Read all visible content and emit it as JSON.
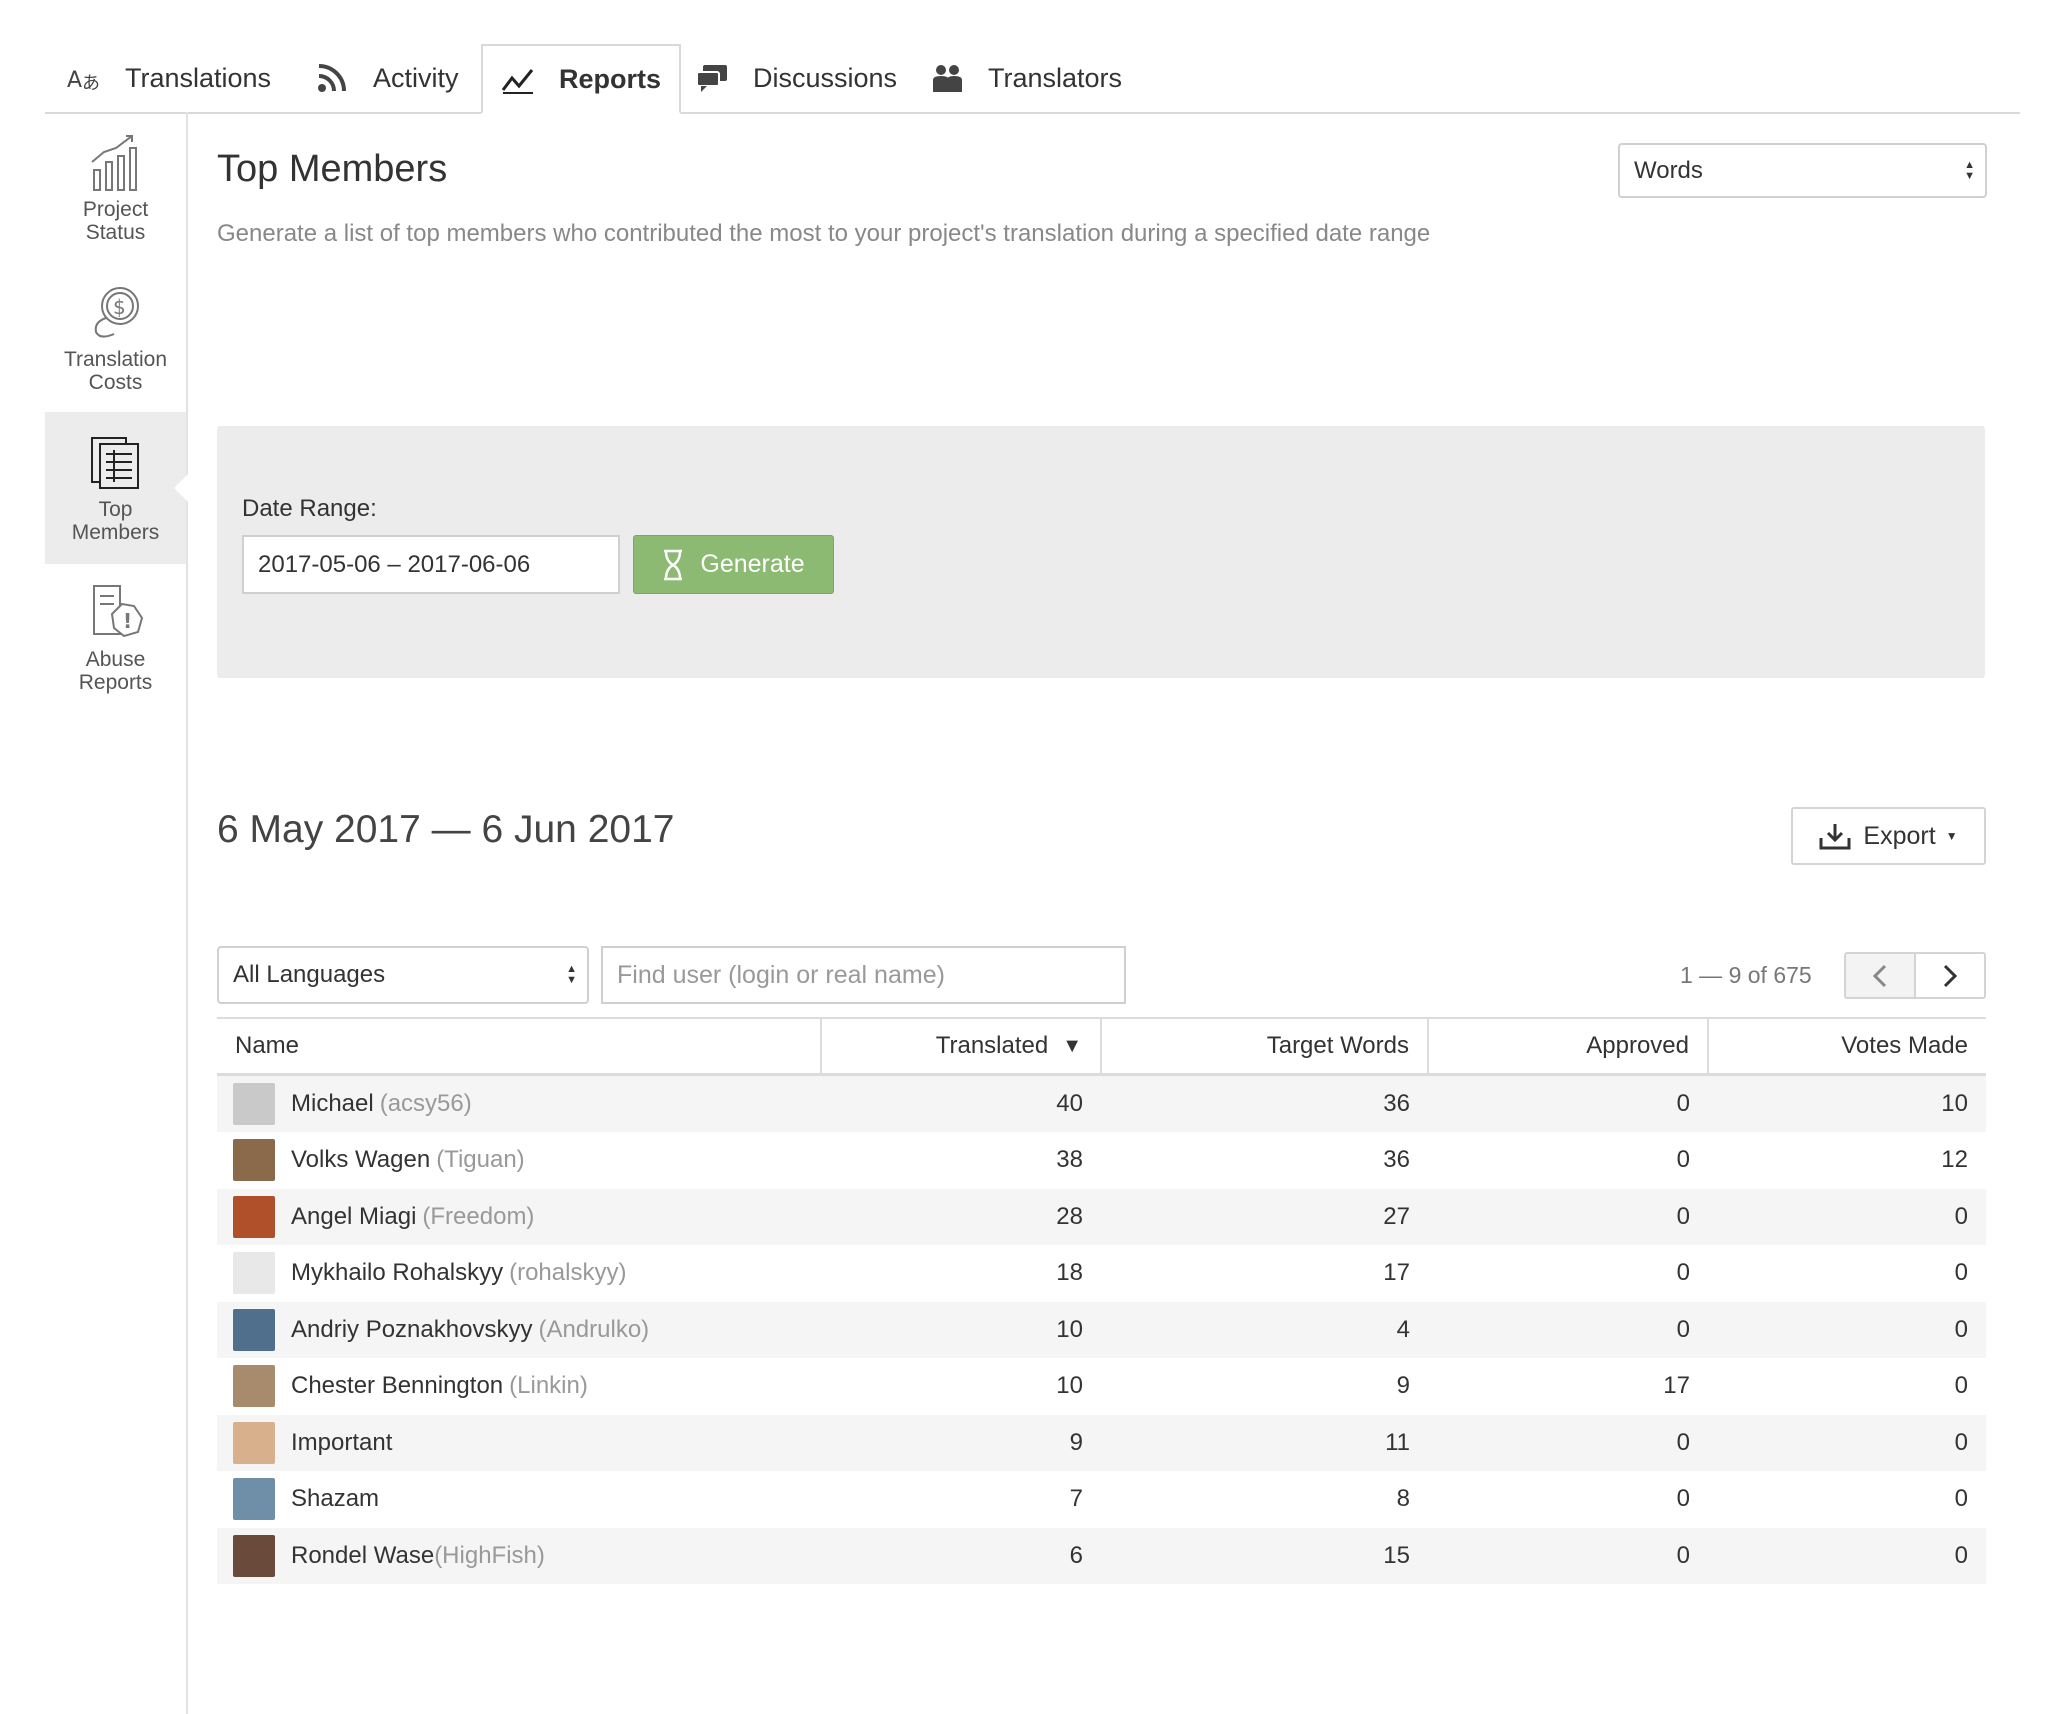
{
  "tabs": [
    {
      "label": "Translations",
      "icon": "translate-icon"
    },
    {
      "label": "Activity",
      "icon": "rss-icon"
    },
    {
      "label": "Reports",
      "icon": "chart-line-icon"
    },
    {
      "label": "Discussions",
      "icon": "chat-icon"
    },
    {
      "label": "Translators",
      "icon": "people-icon"
    }
  ],
  "active_tab": "Reports",
  "sidebar": {
    "items": [
      {
        "line1": "Project",
        "line2": "Status",
        "icon": "bar-chart-icon"
      },
      {
        "line1": "Translation",
        "line2": "Costs",
        "icon": "coins-icon"
      },
      {
        "line1": "Top",
        "line2": "Members",
        "icon": "document-list-icon"
      },
      {
        "line1": "Abuse",
        "line2": "Reports",
        "icon": "report-warning-icon"
      }
    ],
    "active": "Top Members"
  },
  "header": {
    "title": "Top Members",
    "description": "Generate a list of top members who contributed the most to your project's translation during a specified date range",
    "unit_select": "Words"
  },
  "filter": {
    "date_label": "Date Range:",
    "date_value": "2017-05-06 – 2017-06-06",
    "generate_label": "Generate"
  },
  "results": {
    "range_title": "6 May 2017 — 6 Jun 2017",
    "export_label": "Export",
    "language_select": "All Languages",
    "search_placeholder": "Find user (login or real name)",
    "pager_text": "1 — 9 of 675"
  },
  "table": {
    "columns": [
      "Name",
      "Translated",
      "Target Words",
      "Approved",
      "Votes Made"
    ],
    "rows": [
      {
        "name": "Michael",
        "login": "(acsy56)",
        "translated": "40",
        "target_words": "36",
        "approved": "0",
        "votes": "10",
        "avatar_color": "#c9c9c9"
      },
      {
        "name": "Volks Wagen",
        "login": "(Tiguan)",
        "translated": "38",
        "target_words": "36",
        "approved": "0",
        "votes": "12",
        "avatar_color": "#8a6a4a"
      },
      {
        "name": "Angel Miagi",
        "login": "(Freedom)",
        "translated": "28",
        "target_words": "27",
        "approved": "0",
        "votes": "0",
        "avatar_color": "#b0502a"
      },
      {
        "name": "Mykhailo Rohalskyy",
        "login": "(rohalskyy)",
        "translated": "18",
        "target_words": "17",
        "approved": "0",
        "votes": "0",
        "avatar_color": "#e8e8e8"
      },
      {
        "name": "Andriy Poznakhovskyy",
        "login": "(Andrulko)",
        "translated": "10",
        "target_words": "4",
        "approved": "0",
        "votes": "0",
        "avatar_color": "#4f6f8c"
      },
      {
        "name": "Chester Bennington",
        "login": "(Linkin)",
        "translated": "10",
        "target_words": "9",
        "approved": "17",
        "votes": "0",
        "avatar_color": "#a88a6c"
      },
      {
        "name": "Important",
        "login": "",
        "translated": "9",
        "target_words": "11",
        "approved": "0",
        "votes": "0",
        "avatar_color": "#d9b08c"
      },
      {
        "name": "Shazam",
        "login": "",
        "translated": "7",
        "target_words": "8",
        "approved": "0",
        "votes": "0",
        "avatar_color": "#6f8fa8"
      },
      {
        "name": "Rondel Wase",
        "login": "(HighFish)",
        "translated": "6",
        "target_words": "15",
        "approved": "0",
        "votes": "0",
        "avatar_color": "#6a4a3a"
      }
    ]
  },
  "colors": {
    "accent_green": "#8cba72",
    "muted_text": "#999999",
    "panel_bg": "#ececec"
  }
}
